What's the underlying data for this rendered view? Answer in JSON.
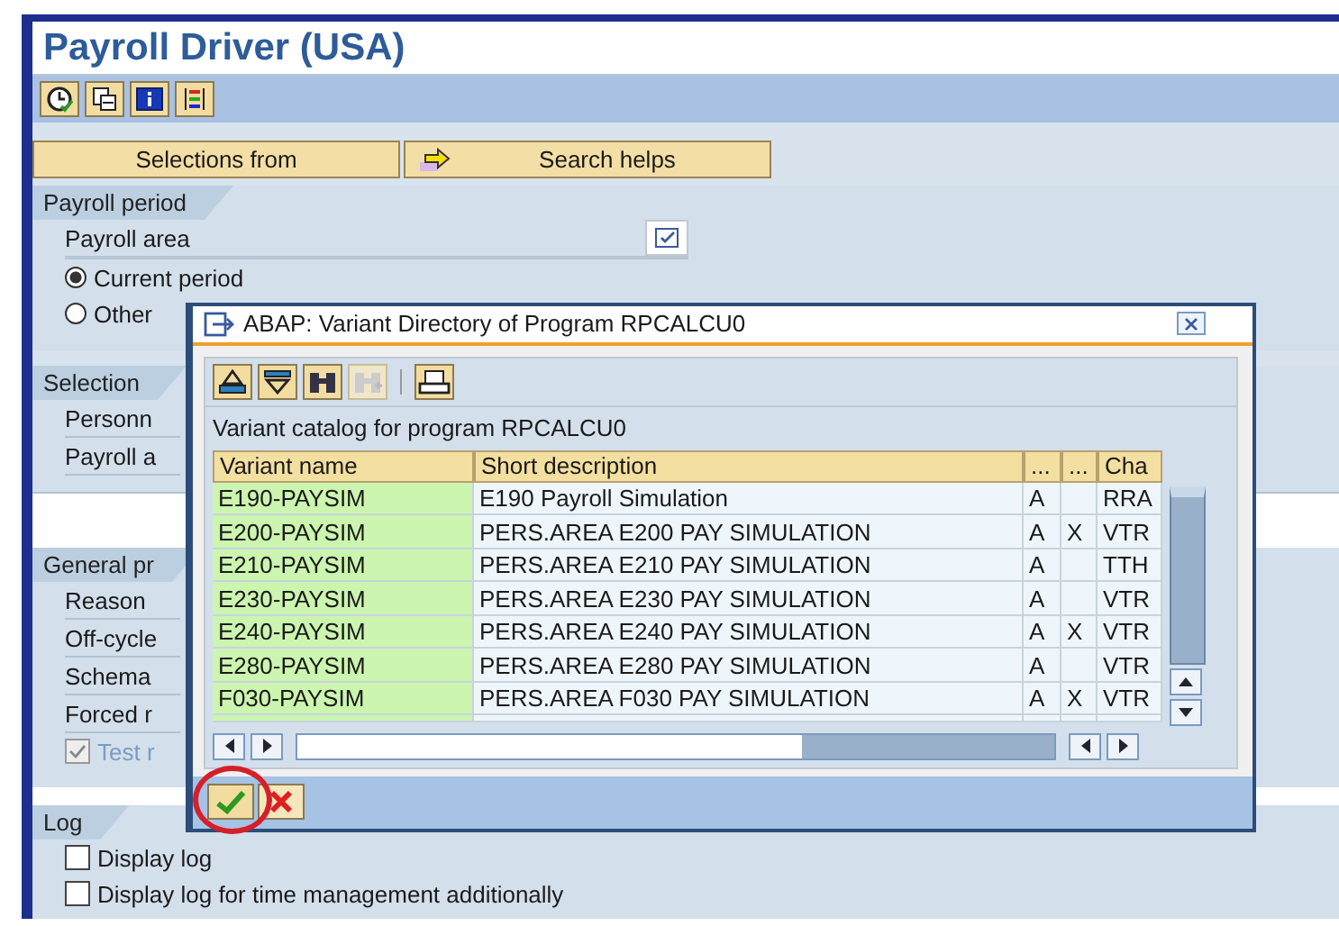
{
  "window": {
    "title": "Payroll Driver (USA)"
  },
  "buttons": {
    "selections": "Selections from",
    "search_helps": "Search helps"
  },
  "payroll_period": {
    "title": "Payroll period",
    "payroll_area": "Payroll area",
    "options": [
      {
        "label": "Current period",
        "selected": true
      },
      {
        "label": "Other",
        "selected": false
      }
    ]
  },
  "selection": {
    "title": "Selection",
    "fields": [
      "Personn",
      "Payroll a"
    ]
  },
  "general": {
    "title": "General pr",
    "fields": [
      "Reason",
      "Off-cycle",
      "Schema",
      "Forced r"
    ],
    "test_run": {
      "label": "Test r",
      "checked": true,
      "disabled": true
    }
  },
  "log": {
    "title": "Log",
    "options": [
      {
        "label": "Display log",
        "checked": false
      },
      {
        "label": "Display log for time management additionally",
        "checked": false
      }
    ]
  },
  "dialog": {
    "title": "ABAP: Variant Directory of Program RPCALCU0",
    "toolbar": [
      {
        "kind": "sort",
        "disabled": false
      },
      {
        "kind": "filter",
        "disabled": false
      },
      {
        "kind": "find",
        "disabled": false
      },
      {
        "kind": "findnext",
        "disabled": true
      },
      {
        "kind": "print",
        "disabled": false
      }
    ],
    "caption": "Variant catalog for program RPCALCU0",
    "columns": [
      "Variant name",
      "Short description",
      "...",
      "...",
      "Cha"
    ],
    "rows": [
      {
        "variant_name": "E190-PAYSIM",
        "short_description": "E190 Payroll Simulation",
        "column_3": "A",
        "column_5": "RRA"
      },
      {
        "variant_name": "E200-PAYSIM",
        "short_description": "PERS.AREA E200 PAY SIMULATION",
        "column_3": "A",
        "column_4": "X",
        "column_5": "VTR"
      },
      {
        "variant_name": "E210-PAYSIM",
        "short_description": "PERS.AREA E210 PAY SIMULATION",
        "column_3": "A",
        "column_5": "TTH"
      },
      {
        "variant_name": "E230-PAYSIM",
        "short_description": "PERS.AREA E230 PAY SIMULATION",
        "column_3": "A",
        "column_5": "VTR"
      },
      {
        "variant_name": "E240-PAYSIM",
        "short_description": "PERS.AREA E240 PAY SIMULATION",
        "column_3": "A",
        "column_4": "X",
        "column_5": "VTR"
      },
      {
        "variant_name": "E280-PAYSIM",
        "short_description": "PERS.AREA E280 PAY SIMULATION",
        "column_3": "A",
        "column_5": "VTR"
      },
      {
        "variant_name": "F030-PAYSIM",
        "short_description": "PERS.AREA F030 PAY SIMULATION",
        "column_3": "A",
        "column_4": "X",
        "column_5": "VTR"
      }
    ],
    "ok_highlighted": true
  }
}
